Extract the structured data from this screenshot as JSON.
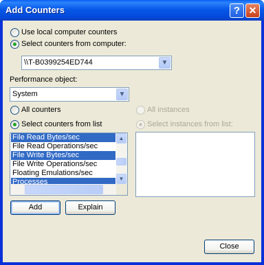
{
  "window": {
    "title": "Add Counters",
    "help_glyph": "?",
    "close_glyph": "✕"
  },
  "source": {
    "local_label": "Use local computer counters",
    "remote_label": "Select counters from computer:",
    "selected": "remote",
    "computer_value": "\\\\T-B0399254ED744"
  },
  "perf_object": {
    "label": "Performance object:",
    "value": "System"
  },
  "counters": {
    "all_label": "All counters",
    "select_label": "Select counters from list",
    "items": [
      {
        "label": "File Read Bytes/sec",
        "selected": true
      },
      {
        "label": "File Read Operations/sec",
        "selected": false
      },
      {
        "label": "File Write Bytes/sec",
        "selected": true
      },
      {
        "label": "File Write Operations/sec",
        "selected": false
      },
      {
        "label": "Floating Emulations/sec",
        "selected": false
      },
      {
        "label": "Processes",
        "selected": true
      }
    ]
  },
  "instances": {
    "all_label": "All instances",
    "select_label": "Select instances from list:"
  },
  "buttons": {
    "add": "Add",
    "explain": "Explain",
    "close": "Close"
  },
  "icons": {
    "combo_arrow": "chevron-down-icon",
    "scroll_up": "arrow-up-icon",
    "scroll_down": "arrow-down-icon"
  },
  "colors": {
    "title_bar": "#0758e8",
    "dialog_bg": "#ece9d8",
    "selection": "#316ac5",
    "radio_dot": "#21a121"
  }
}
